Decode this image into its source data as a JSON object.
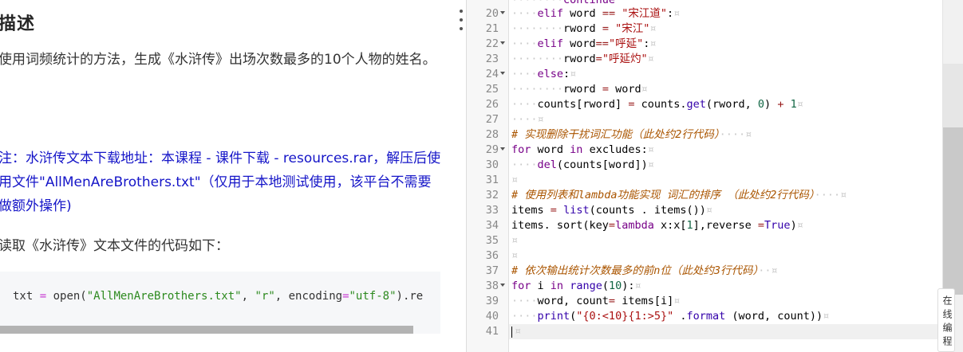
{
  "description": {
    "title": "描述",
    "paragraph1": "使用词频统计的方法，生成《水浒传》出场次数最多的10个人物的姓名。",
    "note": "注：水浒传文本下载地址：本课程 - 课件下载 - resources.rar，解压后使用文件\"AllMenAreBrothers.txt\"（仅用于本地测试使用，该平台不需要做额外操作)",
    "paragraph3": "读取《水浒传》文本文件的代码如下：",
    "code_parts": [
      "txt ",
      "=",
      " open(",
      "\"AllMenAreBrothers.txt\"",
      ", ",
      "\"r\"",
      ", encoding",
      "=",
      "\"utf-8\"",
      ").re"
    ]
  },
  "editor": {
    "lines": [
      {
        "n": "20",
        "fold": true
      },
      {
        "n": "21",
        "fold": false
      },
      {
        "n": "22",
        "fold": true
      },
      {
        "n": "23",
        "fold": false
      },
      {
        "n": "24",
        "fold": true
      },
      {
        "n": "25",
        "fold": false
      },
      {
        "n": "26",
        "fold": false
      },
      {
        "n": "27",
        "fold": false
      },
      {
        "n": "28",
        "fold": false
      },
      {
        "n": "29",
        "fold": true
      },
      {
        "n": "30",
        "fold": false
      },
      {
        "n": "31",
        "fold": false
      },
      {
        "n": "32",
        "fold": false
      },
      {
        "n": "33",
        "fold": false
      },
      {
        "n": "34",
        "fold": false
      },
      {
        "n": "35",
        "fold": false
      },
      {
        "n": "36",
        "fold": false
      },
      {
        "n": "37",
        "fold": false
      },
      {
        "n": "38",
        "fold": true
      },
      {
        "n": "39",
        "fold": false
      },
      {
        "n": "40",
        "fold": false
      },
      {
        "n": "41",
        "fold": false
      }
    ],
    "top_partial": "continue",
    "code": {
      "l20": [
        "elif",
        " word ",
        "==",
        " ",
        "\"宋江道\"",
        ":"
      ],
      "l21": [
        "rword ",
        "=",
        " ",
        "\"宋江\""
      ],
      "l22": [
        "elif",
        " word",
        "==",
        "\"呼延\"",
        ":"
      ],
      "l23": [
        "rword",
        "=",
        "\"呼延灼\""
      ],
      "l24": [
        "else",
        ":"
      ],
      "l25": [
        "rword ",
        "=",
        " word"
      ],
      "l26": [
        "counts[rword] ",
        "=",
        " counts.",
        "get",
        "(rword, ",
        "0",
        ") ",
        "+",
        " ",
        "1"
      ],
      "l28": "# 实现删除干扰词汇功能（此处约2行代码）",
      "l29": [
        "for",
        " word ",
        "in",
        " excludes:"
      ],
      "l30": [
        "del",
        "(counts[word])"
      ],
      "l32": "# 使用列表和lambda功能实现 词汇的排序 （此处约2行代码）",
      "l33": [
        "items ",
        "=",
        " ",
        "list",
        "(counts . items())"
      ],
      "l34": [
        "items. sort(key",
        "=",
        "lambda",
        " x:x[",
        "1",
        "],reverse ",
        "=",
        "True",
        ")"
      ],
      "l37": "# 依次输出统计次数最多的前n位（此处约3行代码）",
      "l38": [
        "for",
        " i ",
        "in",
        " ",
        "range",
        "(",
        "10",
        "):"
      ],
      "l39": [
        "word, count",
        "=",
        " items[i]"
      ],
      "l40": [
        "print",
        "(",
        "\"{0:<10}{1:>5}\"",
        " .",
        "format",
        " (word, count))"
      ]
    }
  },
  "sidebar": {
    "online_label": "在线编程"
  }
}
